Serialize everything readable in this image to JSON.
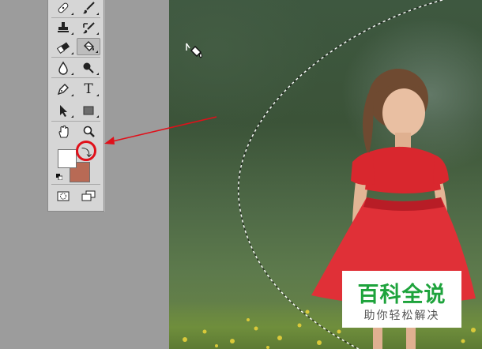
{
  "toolbar": {
    "tools": [
      {
        "name": "spot-healing-brush",
        "icon": "bandage-icon"
      },
      {
        "name": "brush",
        "icon": "brush-icon"
      },
      {
        "name": "clone-stamp",
        "icon": "stamp-icon"
      },
      {
        "name": "history-brush",
        "icon": "history-brush-icon"
      },
      {
        "name": "eraser",
        "icon": "eraser-icon"
      },
      {
        "name": "paint-bucket",
        "icon": "paint-bucket-icon",
        "active": true
      },
      {
        "name": "blur",
        "icon": "droplet-icon"
      },
      {
        "name": "dodge",
        "icon": "dodge-icon"
      },
      {
        "name": "pen",
        "icon": "pen-icon"
      },
      {
        "name": "type",
        "icon": "type-icon",
        "label": "T"
      },
      {
        "name": "path-selection",
        "icon": "arrow-select-icon"
      },
      {
        "name": "rectangle",
        "icon": "rectangle-icon"
      },
      {
        "name": "hand",
        "icon": "hand-icon"
      },
      {
        "name": "zoom",
        "icon": "zoom-icon"
      }
    ],
    "foreground_color": "#ffffff",
    "background_color": "#b86a55",
    "swap_glyph": "⤵"
  },
  "annotation": {
    "color": "#e0101a"
  },
  "watermark": {
    "title": "百科全说",
    "subtitle": "助你轻松解决",
    "title_color": "#1ea33c"
  }
}
